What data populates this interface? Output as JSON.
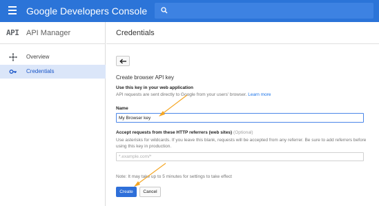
{
  "app": {
    "brand": "Google Developers Console"
  },
  "colors": {
    "topbar": "#2b74d8",
    "accent": "#2e6fd9",
    "link": "#1a73e8",
    "arrow": "#f5a623",
    "nav_selected": "#dbe6f9"
  },
  "nav": {
    "logo": "API",
    "title": "API Manager",
    "items": [
      {
        "label": "Overview",
        "icon": "overview-icon"
      },
      {
        "label": "Credentials",
        "icon": "key-icon",
        "selected": true
      }
    ]
  },
  "main": {
    "title": "Credentials",
    "form": {
      "heading": "Create browser API key",
      "use_heading": "Use this key in your web application",
      "use_desc": "API requests are sent directly to Google from your users' browser.",
      "learn_more": "Learn more",
      "name_label": "Name",
      "name_value": "My Browser key",
      "referrers_label": "Accept requests from these HTTP referrers (web sites)",
      "referrers_optional": "(Optional)",
      "referrers_desc": "Use asterisks for wildcards. If you leave this blank, requests will be accepted from any referrer. Be sure to add referrers before using this key in production.",
      "referrers_placeholder": "*.example.com/*",
      "note": "Note: It may take up to 5 minutes for settings to take effect",
      "create_label": "Create",
      "cancel_label": "Cancel"
    }
  }
}
